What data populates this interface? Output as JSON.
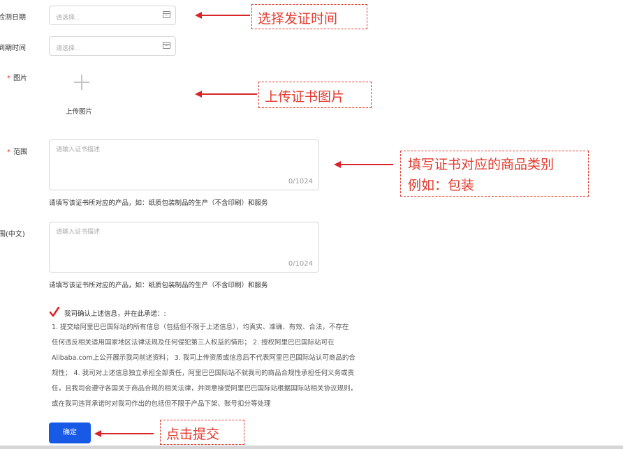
{
  "form": {
    "inspect_date": {
      "label": "检测日期",
      "placeholder": "请选择..."
    },
    "expire_date": {
      "label": "到期时间",
      "placeholder": "请选择..."
    },
    "image": {
      "required_mark": "*",
      "label": "图片",
      "upload_text": "上传图片"
    },
    "scope": {
      "required_mark": "*",
      "label": "范围",
      "placeholder": "请输入证书描述",
      "counter": "0/1024",
      "hint": "请填写该证书所对应的产品，如：纸质包装制品的生产（不含印刷）和服务"
    },
    "scope_cn": {
      "label": "范围(中文)",
      "placeholder": "请输入证书描述",
      "counter": "0/1024",
      "hint": "请填写该证书所对应的产品，如：纸质包装制品的生产（不含印刷）和服务"
    }
  },
  "commitment": {
    "checkbox_title": "我司确认上述信息，并在此承诺：:",
    "lines": [
      "1. 提交给阿里巴巴国际站的所有信息（包括但不限于上述信息），均真实、准确、有效、合法，不存在",
      "任何违反相关适用国家地区法律法规及任何侵犯第三人权益的情形；  2. 授权阿里巴巴国际站可在",
      "Alibaba.com上公开展示我司前述资料；  3. 我司上传资质或信息后不代表阿里巴巴国际站认可商品的合",
      "规性；  4. 我司对上述信息独立承担全部责任，阿里巴巴国际站不就我司的商品合规性承担任何义务或责",
      "任，且我司会遵守各国关于商品合规的相关法律，并同意接受阿里巴巴国际站根据国际站相关协议规则，",
      "或在我司违背承诺时对我司作出的包括但不限于产品下架、账号扣分等处理"
    ]
  },
  "submit": {
    "label": "确定"
  },
  "annotations": {
    "date_note": "选择发证时间",
    "image_note": "上传证书图片",
    "scope_note_line1": "填写证书对应的商品类别",
    "scope_note_line2": "例如：包装",
    "submit_note": "点击提交"
  },
  "colors": {
    "accent": "#1859e6",
    "annotation": "#e23a2e",
    "check": "#d9252a"
  }
}
